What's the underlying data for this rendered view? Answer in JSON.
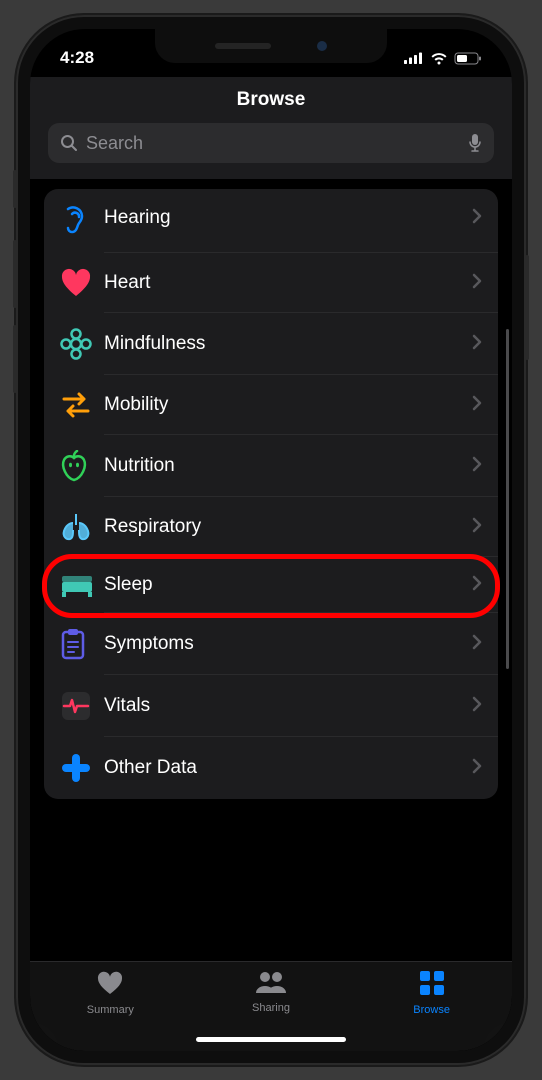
{
  "status": {
    "time": "4:28"
  },
  "header": {
    "title": "Browse"
  },
  "search": {
    "placeholder": "Search"
  },
  "categories": [
    {
      "icon": "hearing",
      "label": "Hearing",
      "color": "#0a84ff"
    },
    {
      "icon": "heart",
      "label": "Heart",
      "color": "#ff375f"
    },
    {
      "icon": "mindfulness",
      "label": "Mindfulness",
      "color": "#40c8b5"
    },
    {
      "icon": "mobility",
      "label": "Mobility",
      "color": "#ff9f0a"
    },
    {
      "icon": "nutrition",
      "label": "Nutrition",
      "color": "#30d158"
    },
    {
      "icon": "respiratory",
      "label": "Respiratory",
      "color": "#5ac8fa"
    },
    {
      "icon": "sleep",
      "label": "Sleep",
      "color": "#40c8b5"
    },
    {
      "icon": "symptoms",
      "label": "Symptoms",
      "color": "#5e5ce6"
    },
    {
      "icon": "vitals",
      "label": "Vitals",
      "color": "#ff375f"
    },
    {
      "icon": "other",
      "label": "Other Data",
      "color": "#0a84ff"
    }
  ],
  "highlighted_index": 6,
  "tabs": [
    {
      "icon": "summary",
      "label": "Summary",
      "active": false
    },
    {
      "icon": "sharing",
      "label": "Sharing",
      "active": false
    },
    {
      "icon": "browse",
      "label": "Browse",
      "active": true
    }
  ]
}
